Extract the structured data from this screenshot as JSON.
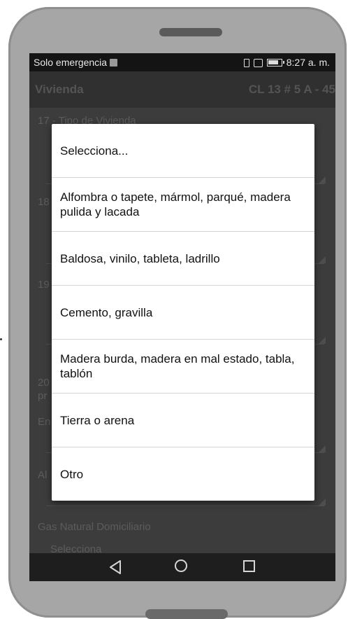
{
  "status_bar": {
    "carrier": "Solo emergencia",
    "time": "8:27 a. m."
  },
  "app_bar": {
    "title": "Vivienda",
    "address": "CL 13 # 5 A - 45"
  },
  "form": {
    "field_17_label": "17 - Tipo de Vivienda",
    "field_18_label": "18",
    "field_19_label": "19",
    "field_20_label_line1": "20",
    "field_20_label_line2": "pr",
    "energy_label": "En",
    "sewer_label": "Al",
    "gas_label": "Gas Natural Domiciliario",
    "gas_value": "Selecciona"
  },
  "dialog": {
    "options": [
      "Selecciona...",
      "Alfombra o tapete, mármol, parqué, madera pulida y lacada",
      "Baldosa, vinilo, tableta, ladrillo",
      "Cemento, gravilla",
      "Madera burda, madera en mal estado, tabla, tablón",
      "Tierra o arena",
      "Otro"
    ]
  },
  "icons": {
    "back": "back-triangle-icon",
    "home": "home-circle-icon",
    "recent": "recent-apps-square-icon"
  }
}
